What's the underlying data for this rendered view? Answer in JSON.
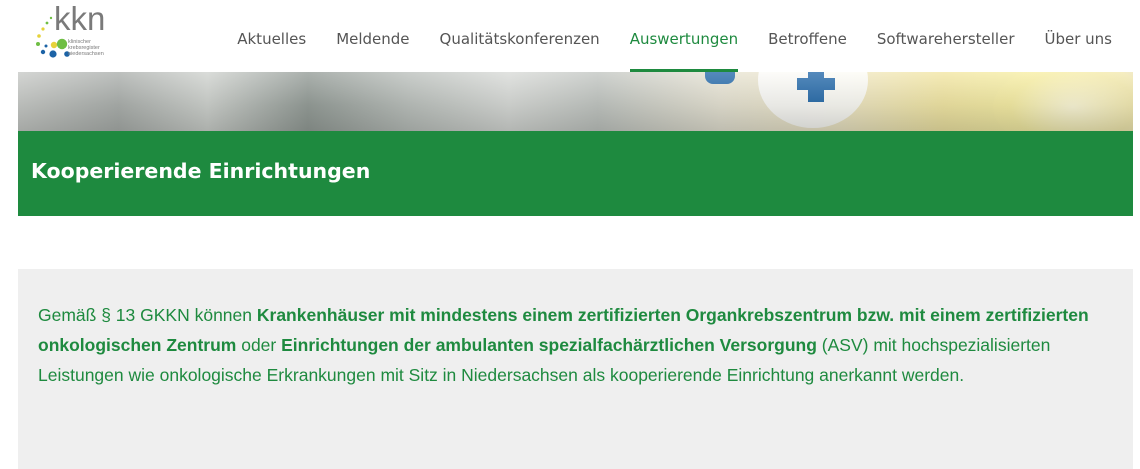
{
  "brand": {
    "logo_text": "kkn",
    "logo_subline": [
      "klinischer",
      "krebsregister",
      "niedersachsen"
    ],
    "colors": {
      "primary_green": "#1e8a3f",
      "nav_text": "#555555",
      "panel_bg": "#efefef",
      "logo_dot_green": "#6fbe44",
      "logo_dot_blue": "#1c63a6",
      "logo_dot_yellow": "#e6d23a"
    }
  },
  "nav": {
    "items": [
      {
        "label": "Aktuelles",
        "active": false
      },
      {
        "label": "Meldende",
        "active": false
      },
      {
        "label": "Qualitätskonferenzen",
        "active": false
      },
      {
        "label": "Auswertungen",
        "active": true
      },
      {
        "label": "Betroffene",
        "active": false
      },
      {
        "label": "Softwarehersteller",
        "active": false
      },
      {
        "label": "Über uns",
        "active": false
      }
    ]
  },
  "hero": {
    "image": "banner-photo-medical"
  },
  "page": {
    "title": "Kooperierende Einrichtungen"
  },
  "info": {
    "segments": [
      {
        "text": "Gemäß § 13 GKKN können ",
        "bold": false
      },
      {
        "text": "Krankenhäuser mit mindestens einem zertifizierten Organkrebszentrum bzw. mit einem zertifizierten onkologischen Zentrum",
        "bold": true
      },
      {
        "text": " oder ",
        "bold": false
      },
      {
        "text": "Einrichtungen der ambulanten spezialfachärztlichen Versorgung",
        "bold": true
      },
      {
        "text": " (ASV) mit hochspezialisierten Leistungen wie onkologische Erkrankungen mit Sitz in Niedersachsen als kooperierende Einrichtung anerkannt werden.",
        "bold": false
      }
    ]
  }
}
